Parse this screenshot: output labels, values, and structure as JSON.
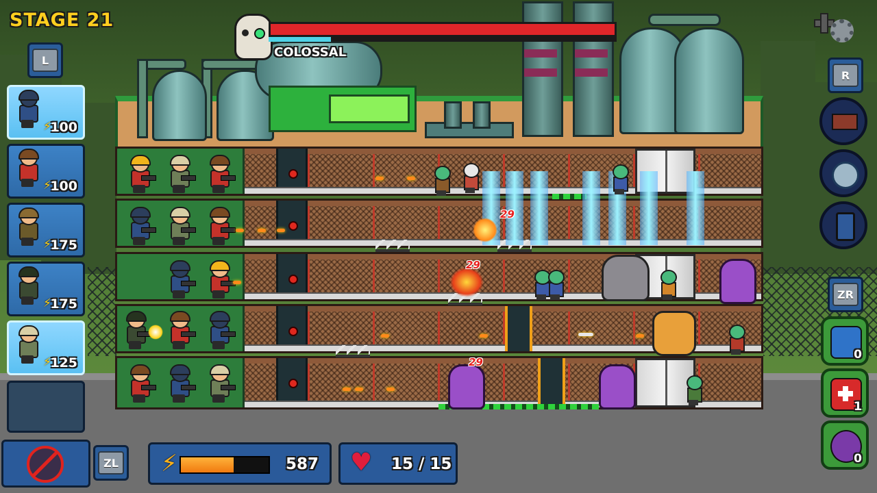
{
  "hud": {
    "stage_label": "STAGE 21",
    "key_l": "L",
    "key_r": "R",
    "key_zl": "ZL",
    "key_zr": "ZR",
    "energy": {
      "value": "587",
      "fill_fraction": 0.6
    },
    "health": {
      "text": "15 / 15"
    },
    "settings_icon": "gear-icon"
  },
  "boss": {
    "name": "COLOSSAL",
    "health_fraction": 1.0,
    "shield_fraction": 0.18,
    "bar_color": "#e0262a"
  },
  "unit_cards": [
    {
      "name": "riot-soldier",
      "cost": "100",
      "active": true
    },
    {
      "name": "rifleman",
      "cost": "100",
      "active": false
    },
    {
      "name": "flamethrower",
      "cost": "175",
      "active": false
    },
    {
      "name": "commander",
      "cost": "175",
      "active": false
    },
    {
      "name": "medic",
      "cost": "125",
      "active": true
    }
  ],
  "damage_numbers": [
    "29",
    "29",
    "29"
  ],
  "items": [
    {
      "name": "lightning-cards",
      "count": "0"
    },
    {
      "name": "medkit",
      "count": "1"
    },
    {
      "name": "virus-bomb",
      "count": "0"
    }
  ],
  "colors": {
    "stage_text": "#ffcf1f",
    "energy": "#f58a1a",
    "heart": "#e01e3c",
    "floor_green": "#2d7d3b"
  }
}
